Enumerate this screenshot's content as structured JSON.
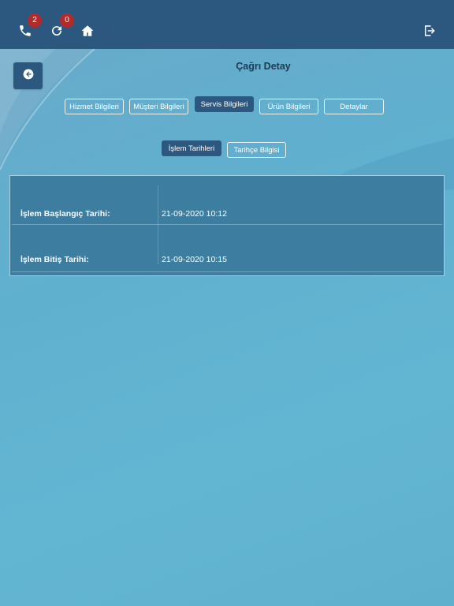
{
  "header": {
    "call_badge": "2",
    "refresh_badge": "0"
  },
  "page": {
    "title": "Çağrı Detay"
  },
  "tabs": [
    {
      "label": "Hizmet Bilgileri",
      "active": false
    },
    {
      "label": "Müşteri Bilgileri",
      "active": false
    },
    {
      "label": "Servis Bilgileri",
      "active": true
    },
    {
      "label": "Ürün Bilgileri",
      "active": false
    },
    {
      "label": "Detaylar",
      "active": false
    }
  ],
  "subtabs": [
    {
      "label": "İşlem Tarihleri",
      "active": true
    },
    {
      "label": "Tarihçe Bilgisi",
      "active": false
    }
  ],
  "details": [
    {
      "label": "İşlem Başlangıç Tarihi:",
      "value": "21-09-2020 10:12"
    },
    {
      "label": "İşlem Bitiş Tarihi:",
      "value": "21-09-2020 10:15"
    }
  ],
  "colors": {
    "header": "#2c5880",
    "accent_active": "#2c5880",
    "badge": "#b32a2a",
    "card": "#3c7da0"
  },
  "icons": [
    "phone-icon",
    "refresh-icon",
    "home-icon",
    "logout-icon",
    "arrow-left-circle-icon"
  ]
}
